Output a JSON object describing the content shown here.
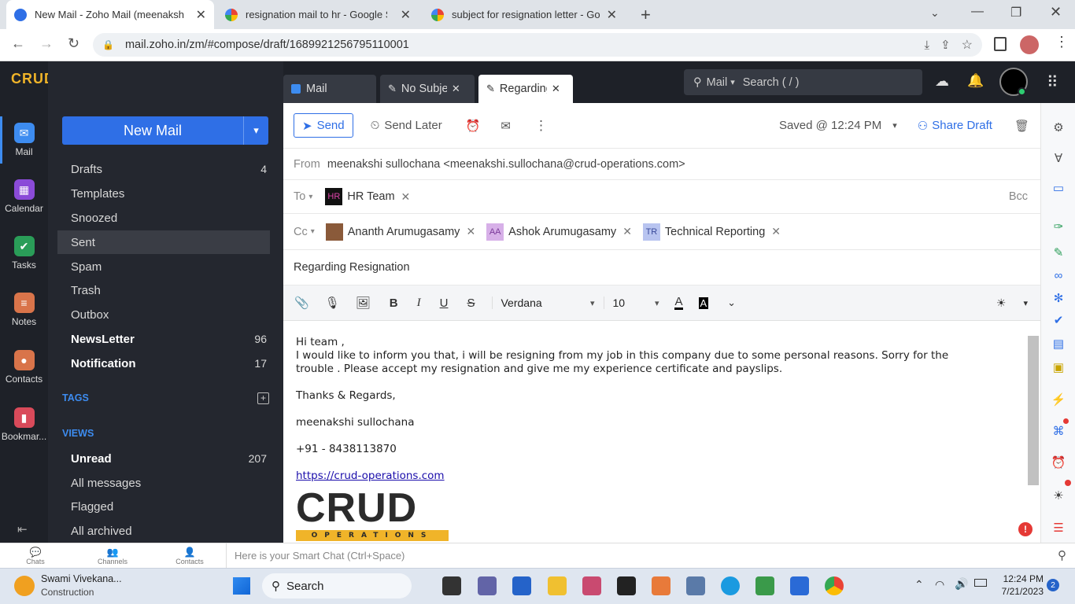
{
  "browser": {
    "tabs": [
      {
        "title": "New Mail - Zoho Mail (meenaksh",
        "active": true
      },
      {
        "title": "resignation mail to hr - Google S",
        "active": false
      },
      {
        "title": "subject for resignation letter - Go",
        "active": false
      }
    ],
    "url": "mail.zoho.in/zm/#compose/draft/1689921256795110001"
  },
  "rail": [
    {
      "label": "Mail",
      "icon": "mail-icon",
      "color": "#3d8cf0"
    },
    {
      "label": "Calendar",
      "icon": "calendar-icon",
      "color": "#8b4bd8"
    },
    {
      "label": "Tasks",
      "icon": "tasks-icon",
      "color": "#2a9d58"
    },
    {
      "label": "Notes",
      "icon": "notes-icon",
      "color": "#d9744a"
    },
    {
      "label": "Contacts",
      "icon": "contacts-icon",
      "color": "#d9744a"
    },
    {
      "label": "Bookmar...",
      "icon": "bookmark-icon",
      "color": "#d94a5a"
    }
  ],
  "folders": {
    "new_mail": "New Mail",
    "items": [
      {
        "label": "Drafts",
        "count": "4",
        "bold": false
      },
      {
        "label": "Templates",
        "count": "",
        "bold": false
      },
      {
        "label": "Snoozed",
        "count": "",
        "bold": false
      },
      {
        "label": "Sent",
        "count": "",
        "bold": false,
        "selected": true
      },
      {
        "label": "Spam",
        "count": "",
        "bold": false
      },
      {
        "label": "Trash",
        "count": "",
        "bold": false
      },
      {
        "label": "Outbox",
        "count": "",
        "bold": false
      },
      {
        "label": "NewsLetter",
        "count": "96",
        "bold": true
      },
      {
        "label": "Notification",
        "count": "17",
        "bold": true
      }
    ],
    "tags_label": "TAGS",
    "views_label": "VIEWS",
    "views": [
      {
        "label": "Unread",
        "count": "207",
        "bold": true
      },
      {
        "label": "All messages",
        "count": "",
        "bold": false
      },
      {
        "label": "Flagged",
        "count": "",
        "bold": false
      },
      {
        "label": "All archived",
        "count": "",
        "bold": false
      }
    ]
  },
  "header": {
    "tabs": [
      "Mail",
      "No Subjec",
      "Regarding"
    ],
    "search_scope": "Mail",
    "search_placeholder": "Search ( / )"
  },
  "compose": {
    "send": "Send",
    "send_later": "Send Later",
    "saved": "Saved @ 12:24 PM",
    "share_draft": "Share Draft",
    "from_label": "From",
    "from_value": "meenakshi sullochana <meenakshi.sullochana@crud-operations.com>",
    "to_label": "To",
    "to": [
      {
        "name": "HR Team",
        "initials": "HR"
      }
    ],
    "bcc": "Bcc",
    "cc_label": "Cc",
    "cc": [
      {
        "name": "Ananth Arumugasamy",
        "initials": ""
      },
      {
        "name": "Ashok Arumugasamy",
        "initials": "AA"
      },
      {
        "name": "Technical Reporting",
        "initials": "TR"
      }
    ],
    "subject": "Regarding Resignation",
    "font": "Verdana",
    "size": "10",
    "body": {
      "greeting": "Hi team ,",
      "line1": "I would like to inform you that, i will be resigning from my job in this company due to some personal reasons. Sorry for the",
      "line2": "trouble . Please accept my resignation and  give me my experience certificate and payslips.",
      "thanks": "Thanks & Regards,",
      "name": "meenakshi sullochana",
      "phone": "+91 - 8438113870",
      "link": "https://crud-operations.com",
      "logo_text": "CRUD",
      "logo_sub": "OPERATIONS"
    }
  },
  "chatbar": {
    "items": [
      "Chats",
      "Channels",
      "Contacts"
    ],
    "placeholder": "Here is your Smart Chat (Ctrl+Space)"
  },
  "taskbar": {
    "news_title": "Swami Vivekana...",
    "news_sub": "Construction",
    "search": "Search",
    "time": "12:24 PM",
    "date": "7/21/2023",
    "badge": "2"
  }
}
